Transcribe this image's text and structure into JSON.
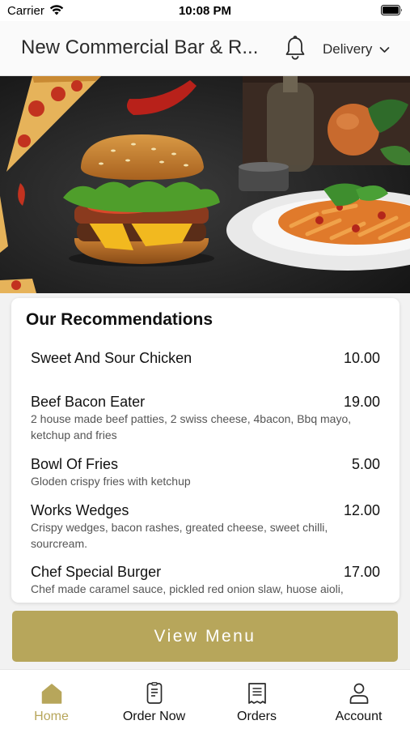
{
  "status_bar": {
    "carrier": "Carrier",
    "time": "10:08 PM"
  },
  "header": {
    "restaurant_name": "New Commercial Bar & R...",
    "notification_icon": "bell-icon",
    "order_mode": "Delivery"
  },
  "hero": {
    "image_subject": "pizza, burger and pasta on dark table"
  },
  "recommendations": {
    "title": "Our Recommendations",
    "items": [
      {
        "name": "Sweet And Sour Chicken",
        "price": "10.00",
        "description": ""
      },
      {
        "name": "Beef Bacon Eater",
        "price": "19.00",
        "description": "2 house made beef patties, 2 swiss cheese, 4bacon, Bbq mayo, ketchup and fries"
      },
      {
        "name": "Bowl Of Fries",
        "price": "5.00",
        "description": "Gloden crispy fries with ketchup"
      },
      {
        "name": "Works Wedges",
        "price": "12.00",
        "description": "Crispy wedges, bacon rashes, greated cheese, sweet chilli, sourcream."
      },
      {
        "name": "Chef Special Burger",
        "price": "17.00",
        "description": "Chef made caramel sauce, pickled red onion slaw, huose aioli,"
      }
    ]
  },
  "view_menu_label": "View Menu",
  "tabs": [
    {
      "label": "Home",
      "icon": "home-icon",
      "active": true
    },
    {
      "label": "Order Now",
      "icon": "order-now-icon",
      "active": false
    },
    {
      "label": "Orders",
      "icon": "receipt-icon",
      "active": false
    },
    {
      "label": "Account",
      "icon": "account-icon",
      "active": false
    }
  ],
  "colors": {
    "accent": "#b7a65b",
    "text": "#111111",
    "muted_text": "#555555",
    "background": "#f2f2f2"
  }
}
